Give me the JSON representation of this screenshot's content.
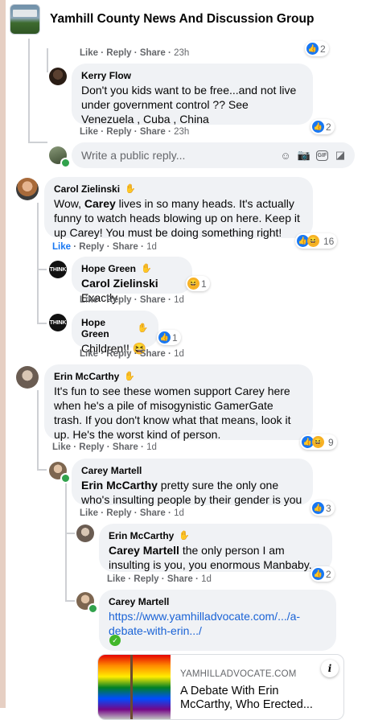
{
  "header": {
    "group_name": "Yamhill County News And Discussion Group"
  },
  "actions": {
    "like": "Like",
    "reply": "Reply",
    "share": "Share",
    "dot": "·"
  },
  "c0": {
    "time": "23h",
    "reactions": "2"
  },
  "kerry": {
    "name": "Kerry Flow",
    "text": "Don't you kids want to be free...and not live under government control ?? See Venezuela , Cuba , China",
    "time": "23h",
    "reactions": "2"
  },
  "reply_box": {
    "placeholder": "Write a public reply..."
  },
  "carol": {
    "name": "Carol Zielinski",
    "text_before": "Wow, ",
    "mention": "Carey",
    "text_after": " lives in so many heads. It's actually funny to watch heads blowing up on here. Keep it up Carey! You must be doing something right!",
    "time": "1d",
    "reactions": "16"
  },
  "hope1": {
    "name": "Hope Green",
    "mention": "Carol Zielinski",
    "text": " Exactly",
    "time": "1d",
    "reactions": "1"
  },
  "hope2": {
    "name": "Hope Green",
    "text": "Children!!",
    "emoji": "😆",
    "time": "1d",
    "reactions": "1"
  },
  "erin1": {
    "name": "Erin McCarthy",
    "text": "It's fun to see these women support Carey here when he's a pile of misogynistic GamerGate trash. If you don't know what that means, look it up. He's the worst kind of person.",
    "time": "1d",
    "reactions": "9"
  },
  "carey1": {
    "name": "Carey Martell",
    "mention": "Erin McCarthy",
    "text": " pretty sure the only one who's insulting people by their gender is you",
    "time": "1d",
    "reactions": "3"
  },
  "erin2": {
    "name": "Erin McCarthy",
    "mention": "Carey Martell",
    "text": " the only person I am insulting is you, you enormous Manbaby.",
    "time": "1d",
    "reactions": "2"
  },
  "carey2": {
    "name": "Carey Martell",
    "link_line1": "https://www.yamhilladvocate.com/.../a-",
    "link_line2": "debate-with-erin.../"
  },
  "preview": {
    "domain": "YAMHILLADVOCATE.COM",
    "title": "A Debate With Erin McCarthy, Who Erected..."
  },
  "badges": {
    "hope": "THINK"
  },
  "colors": {
    "link": "#1a63d6",
    "like_blue": "#1877f2",
    "bubble": "#f0f2f5",
    "online": "#31a24c"
  }
}
